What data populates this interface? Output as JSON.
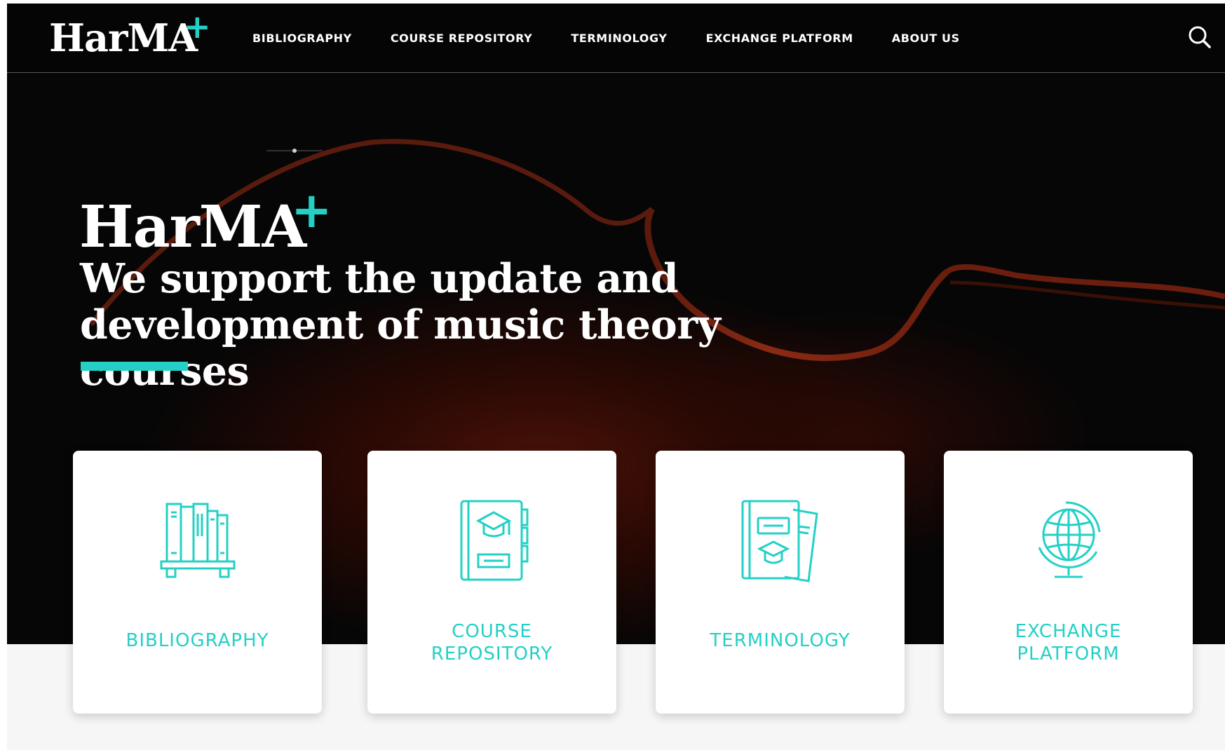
{
  "colors": {
    "accent": "#24d0c6",
    "header_bg": "#050505",
    "hero_bg": "#060606",
    "card_bg": "#ffffff"
  },
  "header": {
    "logo_text": "HarMA",
    "logo_plus": "+",
    "nav": [
      {
        "label": "BIBLIOGRAPHY"
      },
      {
        "label": "COURSE REPOSITORY"
      },
      {
        "label": "TERMINOLOGY"
      },
      {
        "label": "EXCHANGE PLATFORM"
      },
      {
        "label": "ABOUT US"
      }
    ],
    "search_icon": "search-icon"
  },
  "hero": {
    "logo_text": "HarMA",
    "logo_plus": "+",
    "headline_line1": "We support the update and",
    "headline_line2": "development of music theory courses"
  },
  "cards": [
    {
      "icon": "books-icon",
      "label": "BIBLIOGRAPHY"
    },
    {
      "icon": "course-book-icon",
      "label": "COURSE REPOSITORY"
    },
    {
      "icon": "terminology-book-icon",
      "label": "TERMINOLOGY"
    },
    {
      "icon": "globe-icon",
      "label": "EXCHANGE PLATFORM"
    }
  ]
}
